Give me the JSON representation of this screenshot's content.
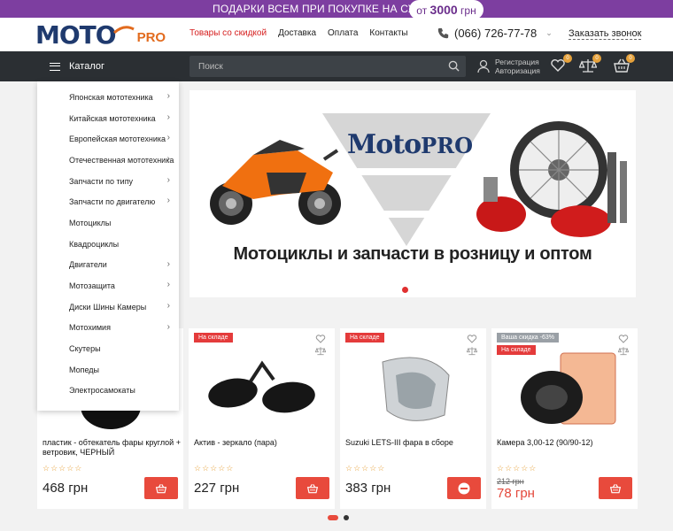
{
  "promo": {
    "text": "ПОДАРКИ ВСЕМ ПРИ ПОКУПКЕ НА СУММУ",
    "pill_prefix": "от",
    "pill_amount": "3000",
    "pill_suffix": "грн"
  },
  "header": {
    "logo_moto": "MOTO",
    "logo_pro": "PRO",
    "nav": [
      "Товары со скидкой",
      "Доставка",
      "Оплата",
      "Контакты"
    ],
    "phone": "(066) 726-77-78",
    "callback": "Заказать звонок"
  },
  "bar": {
    "catalog_label": "Каталог",
    "search_placeholder": "Поиск",
    "register": "Регистрация",
    "login": "Авторизация",
    "badges": [
      "0",
      "0",
      "0"
    ]
  },
  "menu": [
    {
      "label": "Японская мототехника",
      "arrow": true
    },
    {
      "label": "Китайская мототехника",
      "arrow": true
    },
    {
      "label": "Европейская мототехника",
      "arrow": true
    },
    {
      "label": "Отечественная мототехника",
      "arrow": true
    },
    {
      "label": "Запчасти по типу",
      "arrow": true
    },
    {
      "label": "Запчасти по двигателю",
      "arrow": true
    },
    {
      "label": "Мотоциклы",
      "arrow": false
    },
    {
      "label": "Квадроциклы",
      "arrow": false
    },
    {
      "label": "Двигатели",
      "arrow": true
    },
    {
      "label": "Мотозащита",
      "arrow": true
    },
    {
      "label": "Диски Шины Камеры",
      "arrow": true
    },
    {
      "label": "Мотохимия",
      "arrow": true
    },
    {
      "label": "Скутеры",
      "arrow": false
    },
    {
      "label": "Мопеды",
      "arrow": false
    },
    {
      "label": "Электросамокаты",
      "arrow": false
    }
  ],
  "banner": {
    "logo_moto": "Moto",
    "logo_pro": "PRO",
    "text": "Мотоциклы и запчасти в розницу и оптом"
  },
  "products": [
    {
      "name": "пластик - обтекатель фары круглой + ветровик, ЧЕРНЫЙ",
      "price": "468 грн",
      "stock": "",
      "discount": "",
      "old_price": "",
      "stars": "☆☆☆☆☆",
      "cart": "add"
    },
    {
      "name": "Актив - зеркало (пара)",
      "price": "227 грн",
      "stock": "На складе",
      "discount": "",
      "old_price": "",
      "stars": "☆☆☆☆☆",
      "cart": "add"
    },
    {
      "name": "Suzuki LETS-III фара в сборе",
      "price": "383 грн",
      "stock": "На складе",
      "discount": "",
      "old_price": "",
      "stars": "☆☆☆☆☆",
      "cart": "remove"
    },
    {
      "name": "Камера 3,00-12 (90/90-12)",
      "price": "78 грн",
      "stock": "На складе",
      "discount": "Ваша скидка -63%",
      "old_price": "212 грн",
      "stars": "☆☆☆☆☆",
      "cart": "add"
    }
  ],
  "colors": {
    "accent": "#e84a3c",
    "promo_bg": "#7d3ea0",
    "bar_bg": "#2b2f33",
    "logo_blue": "#1f3a6e",
    "logo_orange": "#e26b1e"
  }
}
